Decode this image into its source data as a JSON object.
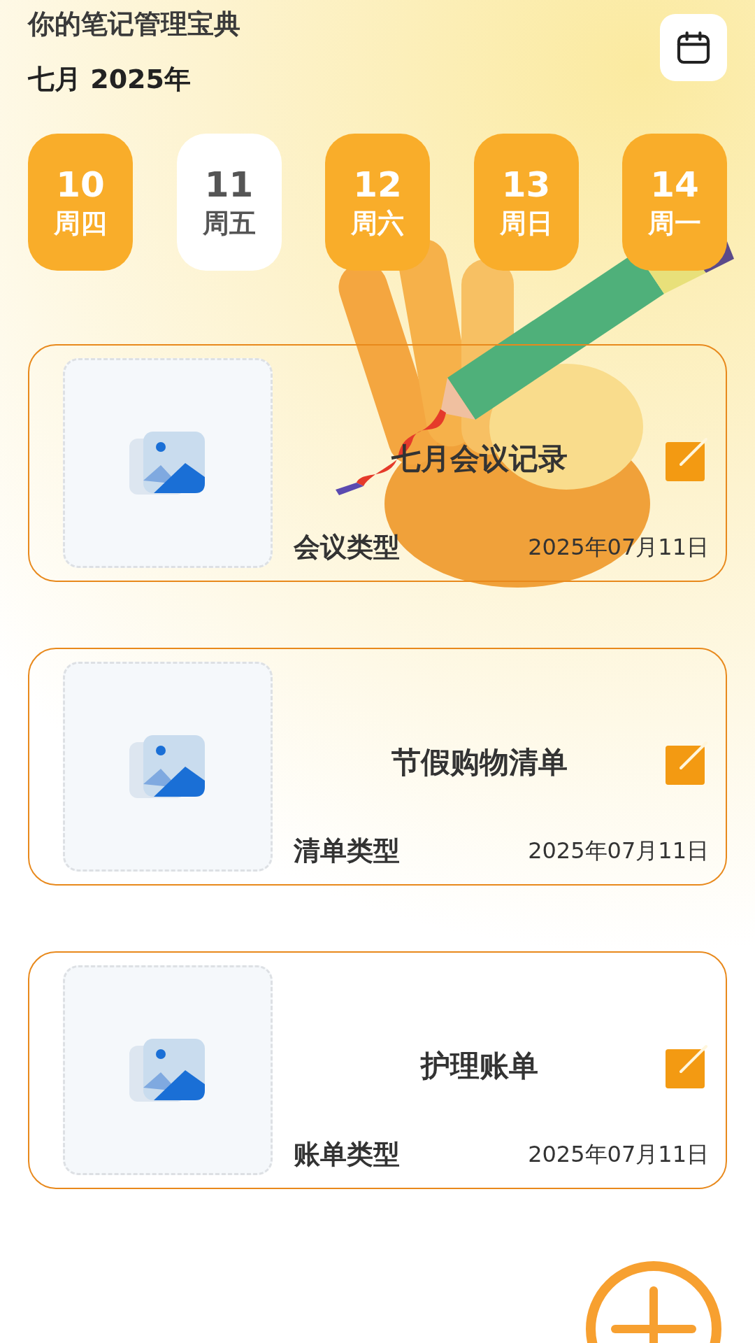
{
  "header": {
    "title": "你的笔记管理宝典",
    "month": "七月 2025年"
  },
  "days": [
    {
      "day": "10",
      "weekday": "周四",
      "selected": false
    },
    {
      "day": "11",
      "weekday": "周五",
      "selected": true
    },
    {
      "day": "12",
      "weekday": "周六",
      "selected": false
    },
    {
      "day": "13",
      "weekday": "周日",
      "selected": false
    },
    {
      "day": "14",
      "weekday": "周一",
      "selected": false
    }
  ],
  "notes": [
    {
      "title": "七月会议记录",
      "type": "会议类型",
      "date": "2025年07月11日"
    },
    {
      "title": "节假购物清单",
      "type": "清单类型",
      "date": "2025年07月11日"
    },
    {
      "title": "护理账单",
      "type": "账单类型",
      "date": "2025年07月11日"
    }
  ]
}
